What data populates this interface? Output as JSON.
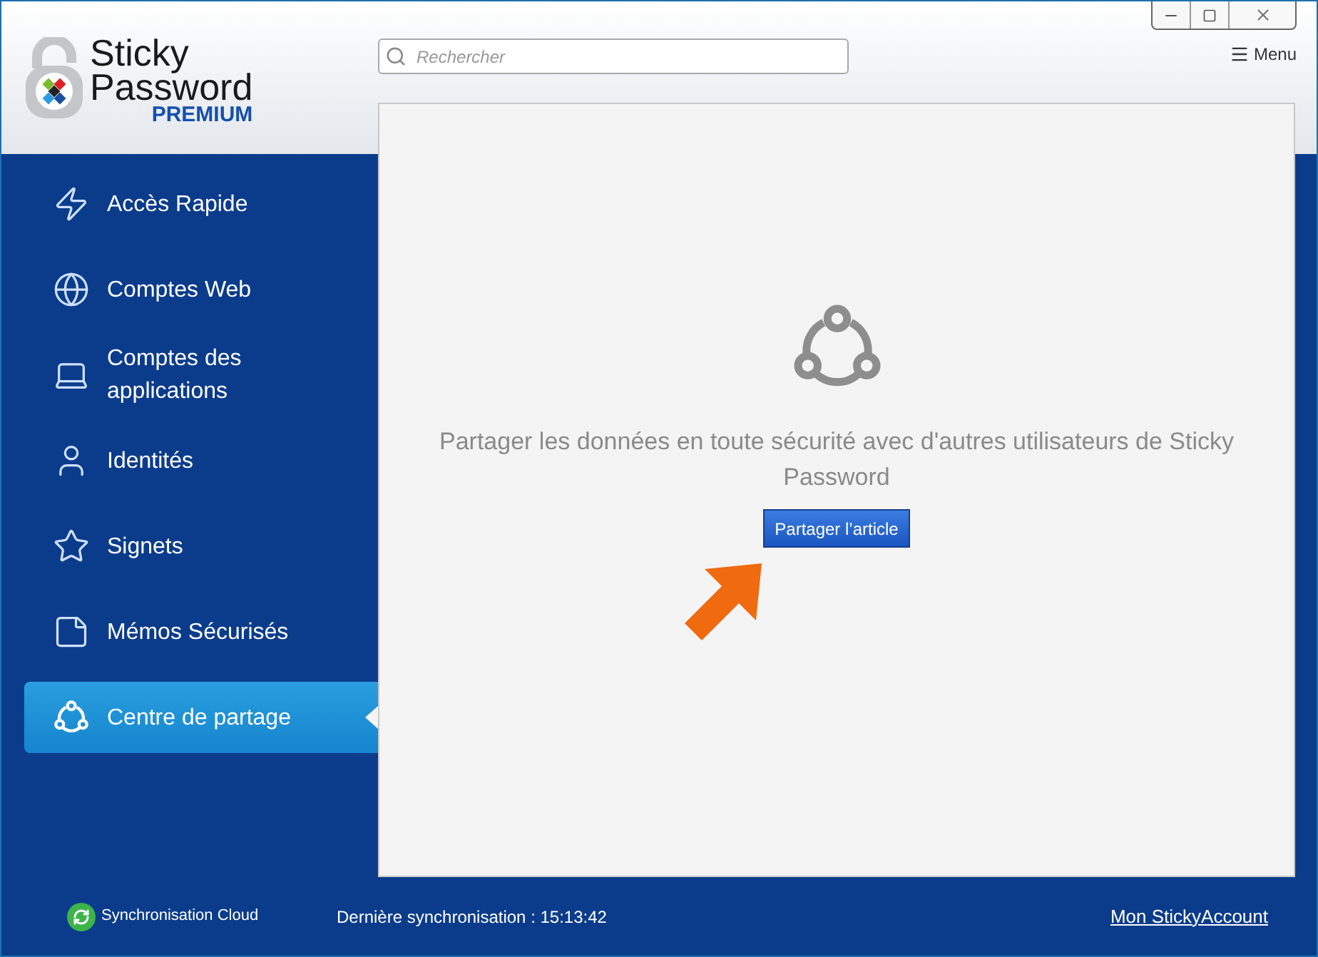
{
  "logo": {
    "line1": "Sticky",
    "line2": "Password",
    "edition": "PREMIUM"
  },
  "search": {
    "placeholder": "Rechercher"
  },
  "menu": {
    "label": "Menu"
  },
  "sidebar": {
    "items": [
      {
        "label": "Accès Rapide",
        "kind": "bolt",
        "selected": false
      },
      {
        "label": "Comptes Web",
        "kind": "globe",
        "selected": false
      },
      {
        "label": "Comptes des applications",
        "kind": "laptop",
        "selected": false
      },
      {
        "label": "Identités",
        "kind": "user",
        "selected": false
      },
      {
        "label": "Signets",
        "kind": "star",
        "selected": false
      },
      {
        "label": "Mémos Sécurisés",
        "kind": "note",
        "selected": false
      },
      {
        "label": "Centre de partage",
        "kind": "share",
        "selected": true
      }
    ]
  },
  "content": {
    "message": "Partager les données en toute sécurité avec d'autres utilisateurs de Sticky Password",
    "button": "Partager l’article"
  },
  "status_bar": {
    "sync_label": "Synchronisation Cloud",
    "last_sync": "Dernière synchronisation : 15:13:42",
    "account_link": "Mon StickyAccount"
  }
}
